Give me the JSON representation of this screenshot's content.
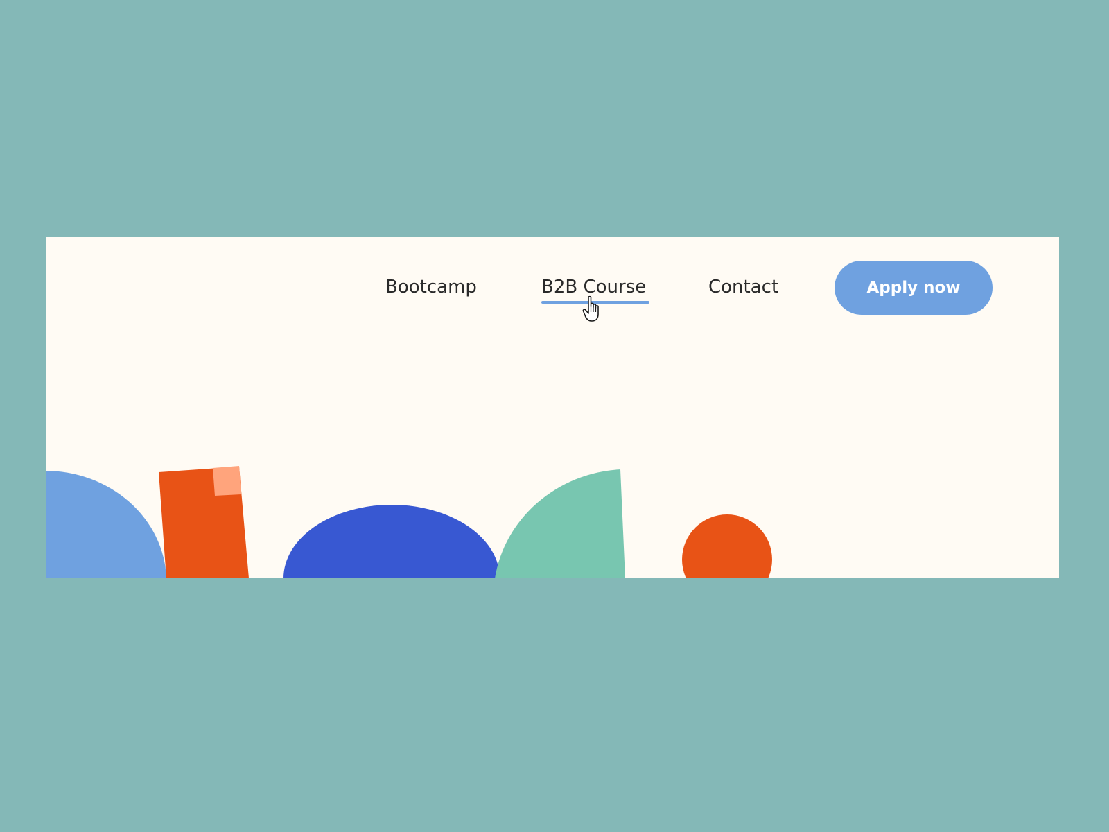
{
  "colors": {
    "backdrop": "#84b8b7",
    "page_bg": "#fffbf4",
    "accent_blue": "#6fa1e0",
    "link_text": "#2a2a2a",
    "orange": "#e85316",
    "peach": "#ffa47c",
    "royal_blue": "#3858d2",
    "mint": "#78c6b0"
  },
  "nav": {
    "links": [
      {
        "label": "Bootcamp"
      },
      {
        "label": "B2B Course"
      },
      {
        "label": "Contact"
      }
    ],
    "active_index": 1,
    "cta_label": "Apply now"
  },
  "icons": {
    "cursor": "hand-pointer-icon"
  }
}
